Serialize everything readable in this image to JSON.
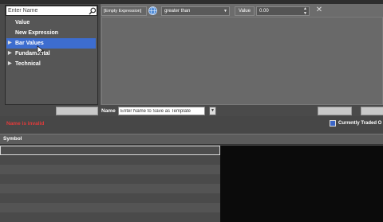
{
  "search": {
    "placeholder": "Enter Name"
  },
  "tree": [
    {
      "label": "Value",
      "expandable": false,
      "selected": false
    },
    {
      "label": "New Expression",
      "expandable": false,
      "selected": false
    },
    {
      "label": "Bar Values",
      "expandable": true,
      "selected": true
    },
    {
      "label": "Fundamental",
      "expandable": true,
      "selected": false
    },
    {
      "label": "Technical",
      "expandable": true,
      "selected": false
    }
  ],
  "filter": {
    "expression": "[Empty Expression]",
    "condition": "greater than",
    "value_label": "Value",
    "value": "0.00"
  },
  "template": {
    "name_label": "Name",
    "name_placeholder": "Enter Name to Save as Template"
  },
  "status": {
    "error_text": "Name is invalid",
    "checkbox_label": "Currently Traded O",
    "checkbox_checked": true
  },
  "table": {
    "columns": [
      "Symbol"
    ],
    "row_count": 8
  },
  "icons": {
    "search": "search-icon",
    "globe": "globe-icon",
    "close": "close-icon",
    "expand": "expand-icon",
    "dropdown": "chevron-down-icon"
  },
  "colors": {
    "selection": "#3d6dcf",
    "error": "#e33b3b",
    "results_right": "#0b0b0b"
  }
}
